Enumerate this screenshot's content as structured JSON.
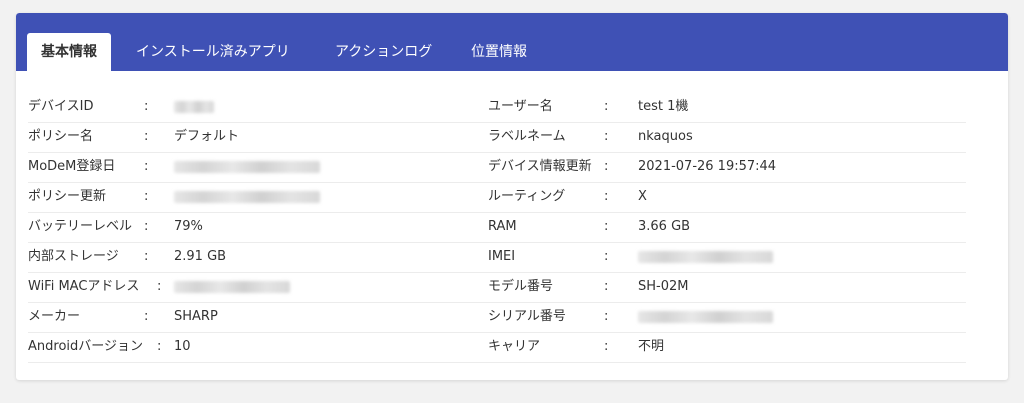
{
  "tabs": [
    {
      "label": "基本情報",
      "active": true
    },
    {
      "label": "インストール済みアプリ"
    },
    {
      "label": "アクションログ"
    },
    {
      "label": "位置情報"
    }
  ],
  "separator": ":",
  "left_fields": [
    {
      "label": "デバイスID",
      "value": "",
      "redacted": true
    },
    {
      "label": "ポリシー名",
      "value": "デフォルト"
    },
    {
      "label": "MoDeM登録日",
      "value": "",
      "redacted": true
    },
    {
      "label": "ポリシー更新",
      "value": "",
      "redacted": true
    },
    {
      "label": "バッテリーレベル",
      "value": "79%"
    },
    {
      "label": "内部ストレージ",
      "value": "2.91 GB"
    },
    {
      "label": "WiFi MACアドレス",
      "value": "",
      "redacted": true
    },
    {
      "label": "メーカー",
      "value": "SHARP"
    },
    {
      "label": "Androidバージョン",
      "value": "10"
    }
  ],
  "right_fields": [
    {
      "label": "ユーザー名",
      "value": "test 1機"
    },
    {
      "label": "ラベルネーム",
      "value": "nkaquos"
    },
    {
      "label": "デバイス情報更新",
      "value": "2021-07-26 19:57:44"
    },
    {
      "label": "ルーティング",
      "value": "X"
    },
    {
      "label": "RAM",
      "value": "3.66 GB"
    },
    {
      "label": "IMEI",
      "value": "",
      "redacted": true
    },
    {
      "label": "モデル番号",
      "value": "SH-02M"
    },
    {
      "label": "シリアル番号",
      "value": "",
      "redacted": true
    },
    {
      "label": "キャリア",
      "value": "不明"
    }
  ],
  "colors": {
    "header": "#3f51b5",
    "background": "#f2f2f2"
  }
}
